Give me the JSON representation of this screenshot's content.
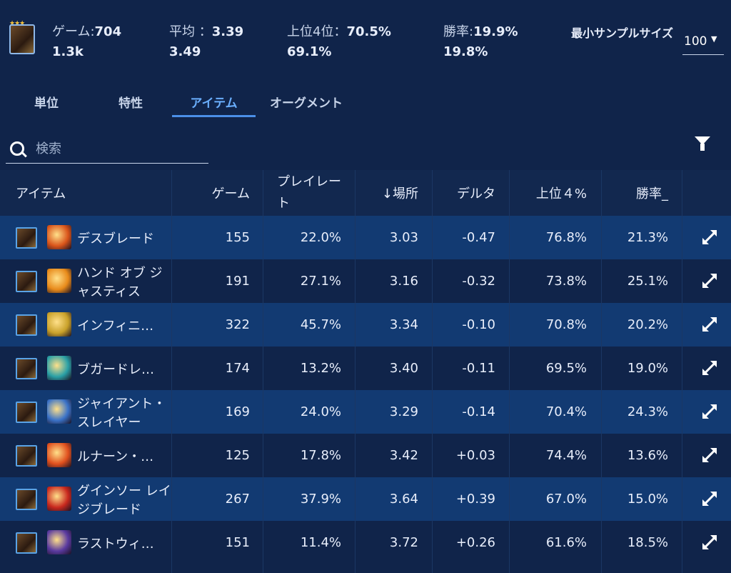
{
  "header": {
    "stars": "★★★",
    "games_label": "ゲーム:",
    "games_value": "704",
    "games_sub": "1.3k",
    "avg_label": "平均 ：",
    "avg_value": "3.39",
    "avg_sub": "3.49",
    "top4_label": "上位4位：",
    "top4_value": "70.5%",
    "top4_sub": "69.1%",
    "win_label": "勝率:",
    "win_value": "19.9%",
    "win_sub": "19.8%",
    "min_sample_label": "最小サンプルサイズ",
    "min_sample_value": "100"
  },
  "tabs": [
    {
      "label": "単位"
    },
    {
      "label": "特性"
    },
    {
      "label": "アイテム"
    },
    {
      "label": "オーグメント"
    }
  ],
  "search": {
    "placeholder": "検索"
  },
  "columns": {
    "item": "アイテム",
    "games": "ゲーム",
    "playrate": "プレイレート",
    "place": "↓場所",
    "delta": "デルタ",
    "top4": "上位４%",
    "winrate": "勝率_"
  },
  "rows": [
    {
      "name": "デスブレード",
      "games": "155",
      "playrate": "22.0%",
      "place": "3.03",
      "delta": "-0.47",
      "top4": "76.8%",
      "winrate": "21.3%",
      "icon_color": "#d9541a"
    },
    {
      "name": "ハンド オブ ジャスティス",
      "games": "191",
      "playrate": "27.1%",
      "place": "3.16",
      "delta": "-0.32",
      "top4": "73.8%",
      "winrate": "25.1%",
      "icon_color": "#e88a1a"
    },
    {
      "name": "インフィニ…",
      "games": "322",
      "playrate": "45.7%",
      "place": "3.34",
      "delta": "-0.10",
      "top4": "70.8%",
      "winrate": "20.2%",
      "icon_color": "#c9a12a"
    },
    {
      "name": "ブガードレ…",
      "games": "174",
      "playrate": "13.2%",
      "place": "3.40",
      "delta": "-0.11",
      "top4": "69.5%",
      "winrate": "19.0%",
      "icon_color": "#2aa0a6"
    },
    {
      "name": "ジャイアント・スレイヤー",
      "games": "169",
      "playrate": "24.0%",
      "place": "3.29",
      "delta": "-0.14",
      "top4": "70.4%",
      "winrate": "24.3%",
      "icon_color": "#3a72c8"
    },
    {
      "name": "ルナーン・…",
      "games": "125",
      "playrate": "17.8%",
      "place": "3.42",
      "delta": "+0.03",
      "top4": "74.4%",
      "winrate": "13.6%",
      "icon_color": "#e0501e"
    },
    {
      "name": "グインソー レイジブレード",
      "games": "267",
      "playrate": "37.9%",
      "place": "3.64",
      "delta": "+0.39",
      "top4": "67.0%",
      "winrate": "15.0%",
      "icon_color": "#c8281e"
    },
    {
      "name": "ラストウィ…",
      "games": "151",
      "playrate": "11.4%",
      "place": "3.72",
      "delta": "+0.26",
      "top4": "61.6%",
      "winrate": "18.5%",
      "icon_color": "#5a3aa0"
    }
  ]
}
